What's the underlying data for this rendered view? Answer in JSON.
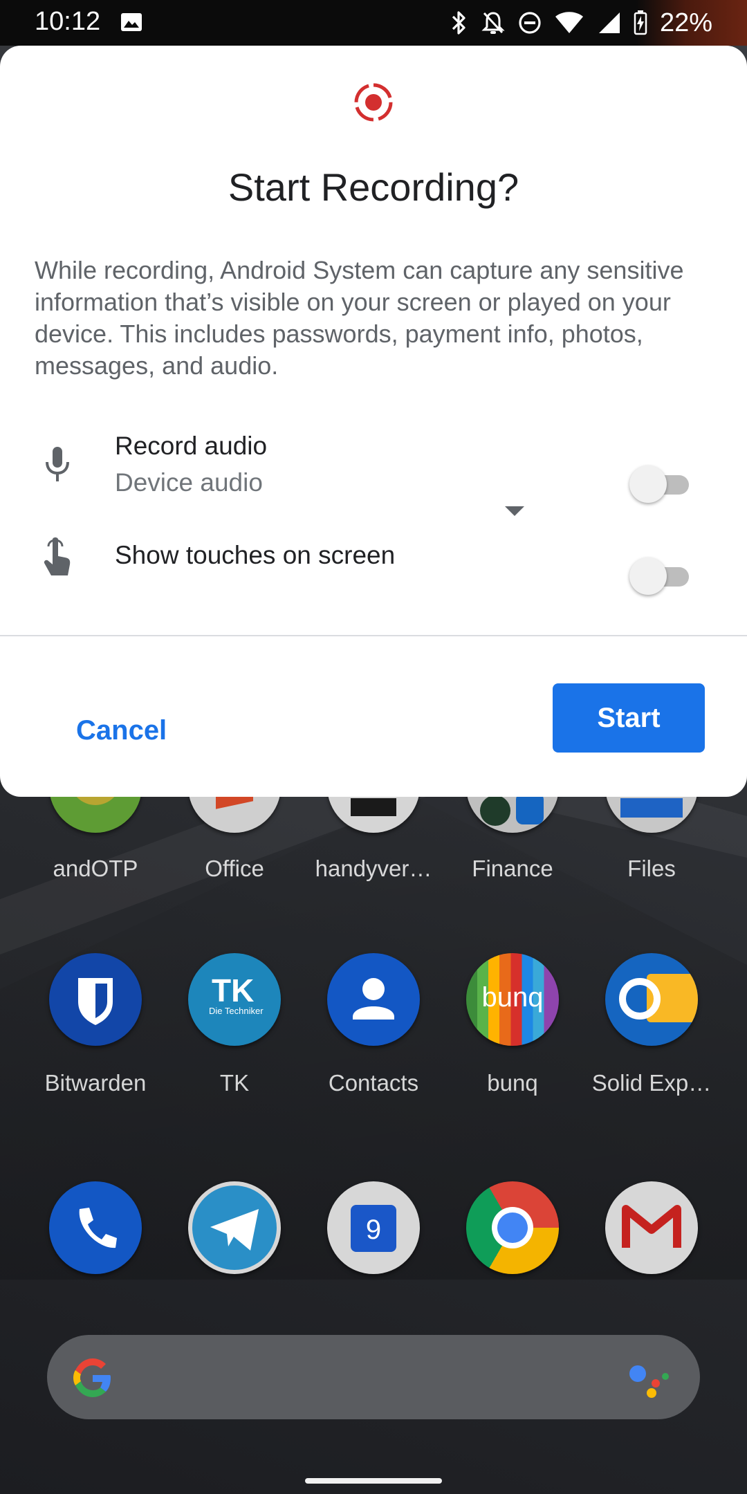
{
  "status_bar": {
    "time": "10:12",
    "battery_percent": "22%",
    "icons": [
      "image-icon",
      "bluetooth-icon",
      "notifications-off-icon",
      "do-not-disturb-icon",
      "wifi-icon",
      "signal-icon",
      "battery-charging-icon"
    ]
  },
  "dialog": {
    "icon": "screen-record-icon",
    "title": "Start Recording?",
    "body": "While recording, Android System can capture any sensitive information that’s visible on your screen or played on your device. This includes passwords, payment info, photos, messages, and audio.",
    "options": [
      {
        "icon": "microphone-icon",
        "title": "Record audio",
        "subtitle": "Device audio",
        "enabled": false
      },
      {
        "icon": "touch-icon",
        "title": "Show touches on screen",
        "enabled": false
      }
    ],
    "cancel_label": "Cancel",
    "start_label": "Start",
    "accent_color": "#1a73e8",
    "record_icon_color": "#d32f2f"
  },
  "home": {
    "row1": [
      {
        "label": "andOTP",
        "icon": "andotp-icon"
      },
      {
        "label": "Office",
        "icon": "office-icon"
      },
      {
        "label": "handyver…",
        "icon": "handyver-icon"
      },
      {
        "label": "Finance",
        "icon": "finance-folder-icon"
      },
      {
        "label": "Files",
        "icon": "files-icon"
      }
    ],
    "row2": [
      {
        "label": "Bitwarden",
        "icon": "bitwarden-icon"
      },
      {
        "label": "TK",
        "icon": "tk-icon",
        "text": "Die Techniker"
      },
      {
        "label": "Contacts",
        "icon": "contacts-icon"
      },
      {
        "label": "bunq",
        "icon": "bunq-icon",
        "text": "bunq"
      },
      {
        "label": "Solid Exp…",
        "icon": "solid-explorer-icon"
      }
    ],
    "dock": [
      {
        "icon": "phone-icon"
      },
      {
        "icon": "telegram-icon"
      },
      {
        "icon": "calendar-icon",
        "text": "9"
      },
      {
        "icon": "chrome-icon"
      },
      {
        "icon": "gmail-icon"
      }
    ],
    "search": {
      "icon": "google-icon",
      "assistant_icon": "assistant-icon"
    }
  }
}
